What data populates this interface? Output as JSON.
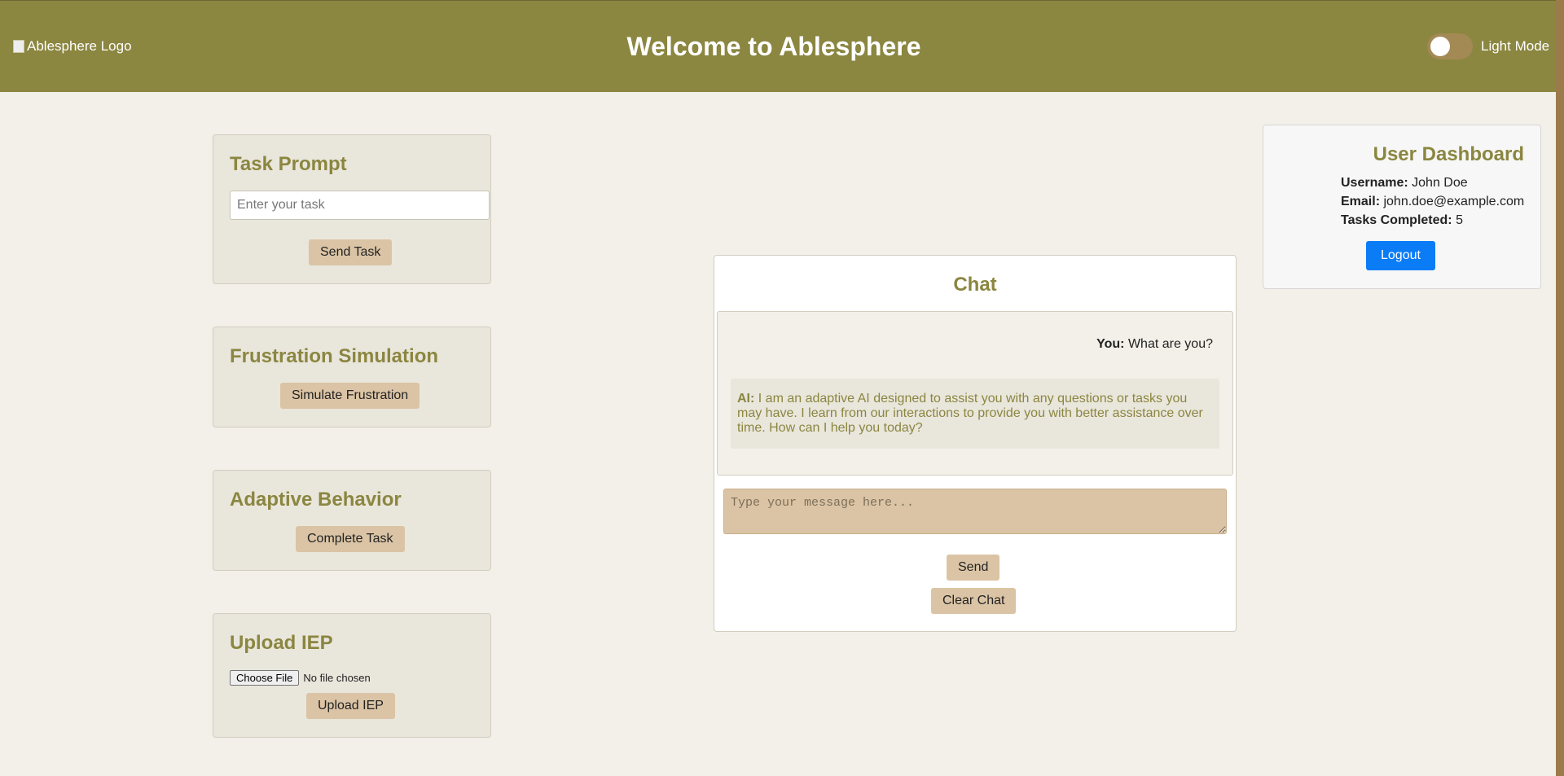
{
  "header": {
    "logo_alt": "Ablesphere Logo",
    "title": "Welcome to Ablesphere",
    "mode_label": "Light Mode",
    "mode_toggle_on": false
  },
  "task_prompt": {
    "title": "Task Prompt",
    "placeholder": "Enter your task",
    "value": "",
    "button": "Send Task"
  },
  "frustration": {
    "title": "Frustration Simulation",
    "button": "Simulate Frustration"
  },
  "adaptive": {
    "title": "Adaptive Behavior",
    "button": "Complete Task"
  },
  "upload": {
    "title": "Upload IEP",
    "choose_label": "Choose File",
    "file_status": "No file chosen",
    "button": "Upload IEP"
  },
  "chat": {
    "title": "Chat",
    "messages": [
      {
        "sender": "You:",
        "text": " What are you?"
      },
      {
        "sender": "AI:",
        "text": " I am an adaptive AI designed to assist you with any questions or tasks you may have. I learn from our interactions to provide you with better assistance over time. How can I help you today?"
      }
    ],
    "input_placeholder": "Type your message here...",
    "send_label": "Send",
    "clear_label": "Clear Chat"
  },
  "dashboard": {
    "title": "User Dashboard",
    "username_label": "Username:",
    "username": " John Doe",
    "email_label": "Email:",
    "email": " john.doe@example.com",
    "tasks_label": "Tasks Completed:",
    "tasks": " 5",
    "logout_label": "Logout"
  },
  "colors": {
    "header_bg": "#8b8640",
    "accent": "#8b8640",
    "button_tan": "#dbc4a5",
    "logout_blue": "#0a7cf6",
    "page_bg": "#f3f0e9"
  }
}
